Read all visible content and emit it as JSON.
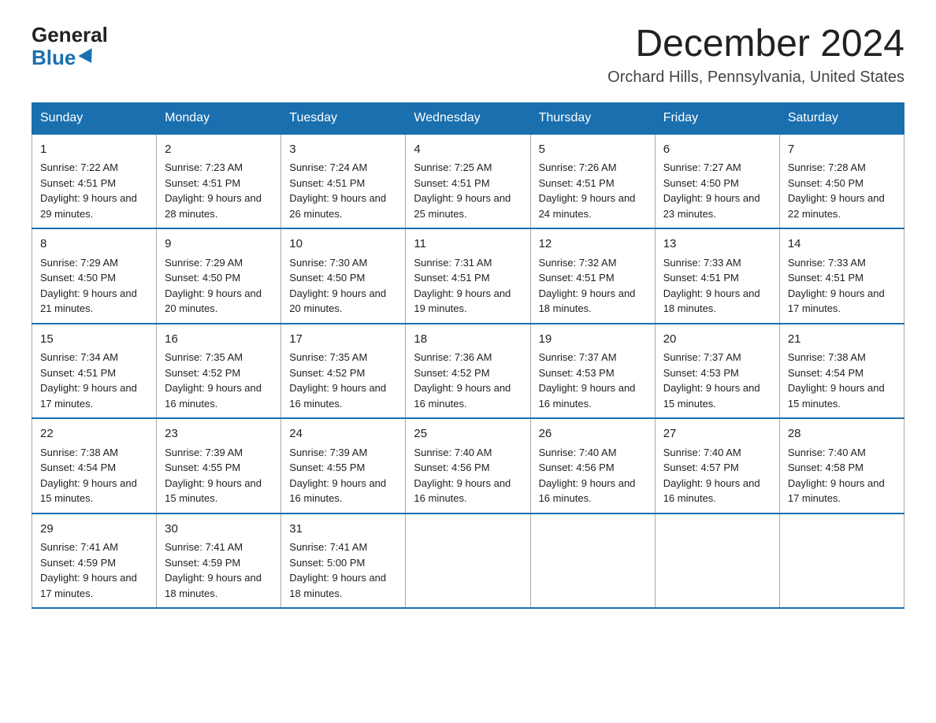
{
  "logo": {
    "general": "General",
    "blue": "Blue"
  },
  "header": {
    "month": "December 2024",
    "location": "Orchard Hills, Pennsylvania, United States"
  },
  "weekdays": [
    "Sunday",
    "Monday",
    "Tuesday",
    "Wednesday",
    "Thursday",
    "Friday",
    "Saturday"
  ],
  "weeks": [
    [
      {
        "day": "1",
        "sunrise": "7:22 AM",
        "sunset": "4:51 PM",
        "daylight": "9 hours and 29 minutes."
      },
      {
        "day": "2",
        "sunrise": "7:23 AM",
        "sunset": "4:51 PM",
        "daylight": "9 hours and 28 minutes."
      },
      {
        "day": "3",
        "sunrise": "7:24 AM",
        "sunset": "4:51 PM",
        "daylight": "9 hours and 26 minutes."
      },
      {
        "day": "4",
        "sunrise": "7:25 AM",
        "sunset": "4:51 PM",
        "daylight": "9 hours and 25 minutes."
      },
      {
        "day": "5",
        "sunrise": "7:26 AM",
        "sunset": "4:51 PM",
        "daylight": "9 hours and 24 minutes."
      },
      {
        "day": "6",
        "sunrise": "7:27 AM",
        "sunset": "4:50 PM",
        "daylight": "9 hours and 23 minutes."
      },
      {
        "day": "7",
        "sunrise": "7:28 AM",
        "sunset": "4:50 PM",
        "daylight": "9 hours and 22 minutes."
      }
    ],
    [
      {
        "day": "8",
        "sunrise": "7:29 AM",
        "sunset": "4:50 PM",
        "daylight": "9 hours and 21 minutes."
      },
      {
        "day": "9",
        "sunrise": "7:29 AM",
        "sunset": "4:50 PM",
        "daylight": "9 hours and 20 minutes."
      },
      {
        "day": "10",
        "sunrise": "7:30 AM",
        "sunset": "4:50 PM",
        "daylight": "9 hours and 20 minutes."
      },
      {
        "day": "11",
        "sunrise": "7:31 AM",
        "sunset": "4:51 PM",
        "daylight": "9 hours and 19 minutes."
      },
      {
        "day": "12",
        "sunrise": "7:32 AM",
        "sunset": "4:51 PM",
        "daylight": "9 hours and 18 minutes."
      },
      {
        "day": "13",
        "sunrise": "7:33 AM",
        "sunset": "4:51 PM",
        "daylight": "9 hours and 18 minutes."
      },
      {
        "day": "14",
        "sunrise": "7:33 AM",
        "sunset": "4:51 PM",
        "daylight": "9 hours and 17 minutes."
      }
    ],
    [
      {
        "day": "15",
        "sunrise": "7:34 AM",
        "sunset": "4:51 PM",
        "daylight": "9 hours and 17 minutes."
      },
      {
        "day": "16",
        "sunrise": "7:35 AM",
        "sunset": "4:52 PM",
        "daylight": "9 hours and 16 minutes."
      },
      {
        "day": "17",
        "sunrise": "7:35 AM",
        "sunset": "4:52 PM",
        "daylight": "9 hours and 16 minutes."
      },
      {
        "day": "18",
        "sunrise": "7:36 AM",
        "sunset": "4:52 PM",
        "daylight": "9 hours and 16 minutes."
      },
      {
        "day": "19",
        "sunrise": "7:37 AM",
        "sunset": "4:53 PM",
        "daylight": "9 hours and 16 minutes."
      },
      {
        "day": "20",
        "sunrise": "7:37 AM",
        "sunset": "4:53 PM",
        "daylight": "9 hours and 15 minutes."
      },
      {
        "day": "21",
        "sunrise": "7:38 AM",
        "sunset": "4:54 PM",
        "daylight": "9 hours and 15 minutes."
      }
    ],
    [
      {
        "day": "22",
        "sunrise": "7:38 AM",
        "sunset": "4:54 PM",
        "daylight": "9 hours and 15 minutes."
      },
      {
        "day": "23",
        "sunrise": "7:39 AM",
        "sunset": "4:55 PM",
        "daylight": "9 hours and 15 minutes."
      },
      {
        "day": "24",
        "sunrise": "7:39 AM",
        "sunset": "4:55 PM",
        "daylight": "9 hours and 16 minutes."
      },
      {
        "day": "25",
        "sunrise": "7:40 AM",
        "sunset": "4:56 PM",
        "daylight": "9 hours and 16 minutes."
      },
      {
        "day": "26",
        "sunrise": "7:40 AM",
        "sunset": "4:56 PM",
        "daylight": "9 hours and 16 minutes."
      },
      {
        "day": "27",
        "sunrise": "7:40 AM",
        "sunset": "4:57 PM",
        "daylight": "9 hours and 16 minutes."
      },
      {
        "day": "28",
        "sunrise": "7:40 AM",
        "sunset": "4:58 PM",
        "daylight": "9 hours and 17 minutes."
      }
    ],
    [
      {
        "day": "29",
        "sunrise": "7:41 AM",
        "sunset": "4:59 PM",
        "daylight": "9 hours and 17 minutes."
      },
      {
        "day": "30",
        "sunrise": "7:41 AM",
        "sunset": "4:59 PM",
        "daylight": "9 hours and 18 minutes."
      },
      {
        "day": "31",
        "sunrise": "7:41 AM",
        "sunset": "5:00 PM",
        "daylight": "9 hours and 18 minutes."
      },
      null,
      null,
      null,
      null
    ]
  ]
}
